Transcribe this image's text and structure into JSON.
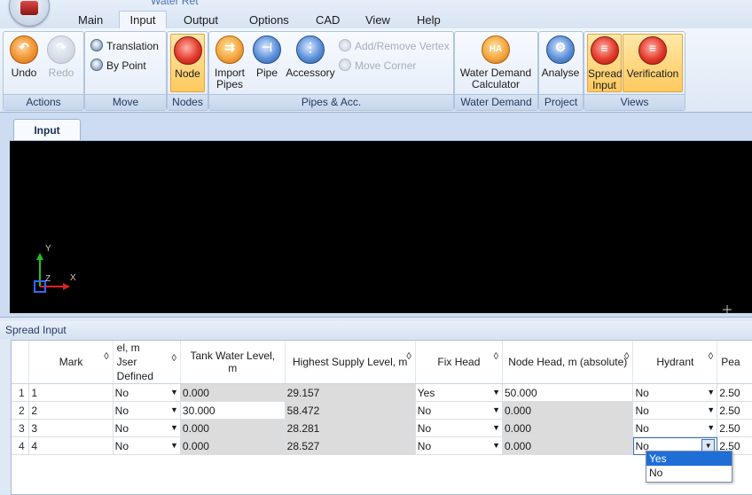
{
  "app": {
    "title": "Water Ret"
  },
  "menu": [
    "Main",
    "Input",
    "Output",
    "Options",
    "CAD",
    "View",
    "Help"
  ],
  "ribbon": {
    "actions": {
      "undo": "Undo",
      "redo": "Redo",
      "label": "Actions"
    },
    "move": {
      "translation": "Translation",
      "by_point": "By Point",
      "label": "Move"
    },
    "nodes": {
      "node": "Node",
      "label": "Nodes"
    },
    "pipes": {
      "import_line1": "Import",
      "import_line2": "Pipes",
      "pipe": "Pipe",
      "accessory": "Accessory",
      "add_remove_vertex": "Add/Remove Vertex",
      "move_corner": "Move Corner",
      "label": "Pipes & Acc."
    },
    "water_demand": {
      "calc_line1": "Water Demand",
      "calc_line2": "Calculator",
      "label": "Water Demand"
    },
    "project": {
      "analyse": "Analyse",
      "label": "Project"
    },
    "views": {
      "spread_line1": "Spread",
      "spread_line2": "Input",
      "verification": "Verification",
      "label": "Views"
    }
  },
  "document_tab": "Input",
  "axes": {
    "y": "Y",
    "z": "Z",
    "x": "X"
  },
  "spread": {
    "title": "Spread Input",
    "columns": {
      "mark": "Mark",
      "level_line1": "el, m",
      "level_line2": "Jser Defined",
      "tank": "Tank Water Level, m",
      "highest": "Highest Supply Level, m",
      "fix": "Fix Head",
      "node_head": "Node Head, m (absolute)",
      "hydrant": "Hydrant",
      "peak": "Pea"
    },
    "sort_glyph": "◊",
    "rows": [
      {
        "num": "1",
        "mark": "1",
        "level": "No",
        "tank": "0.000",
        "highest": "29.157",
        "fix": "Yes",
        "node_head": "50.000",
        "hydrant": "No",
        "peak": "2.50"
      },
      {
        "num": "2",
        "mark": "2",
        "level": "No",
        "tank": "30.000",
        "highest": "58.472",
        "fix": "No",
        "node_head": "0.000",
        "hydrant": "No",
        "peak": "2.50"
      },
      {
        "num": "3",
        "mark": "3",
        "level": "No",
        "tank": "0.000",
        "highest": "28.281",
        "fix": "No",
        "node_head": "0.000",
        "hydrant": "No",
        "peak": "2.50"
      },
      {
        "num": "4",
        "mark": "4",
        "level": "No",
        "tank": "0.000",
        "highest": "28.527",
        "fix": "No",
        "node_head": "0.000",
        "hydrant": "No",
        "peak": "2.50"
      }
    ],
    "dropdown_options": [
      "Yes",
      "No"
    ]
  },
  "colors": {
    "accent": "#1e6ed6",
    "pressed": "#ffc95e",
    "canvas": "#000000"
  }
}
